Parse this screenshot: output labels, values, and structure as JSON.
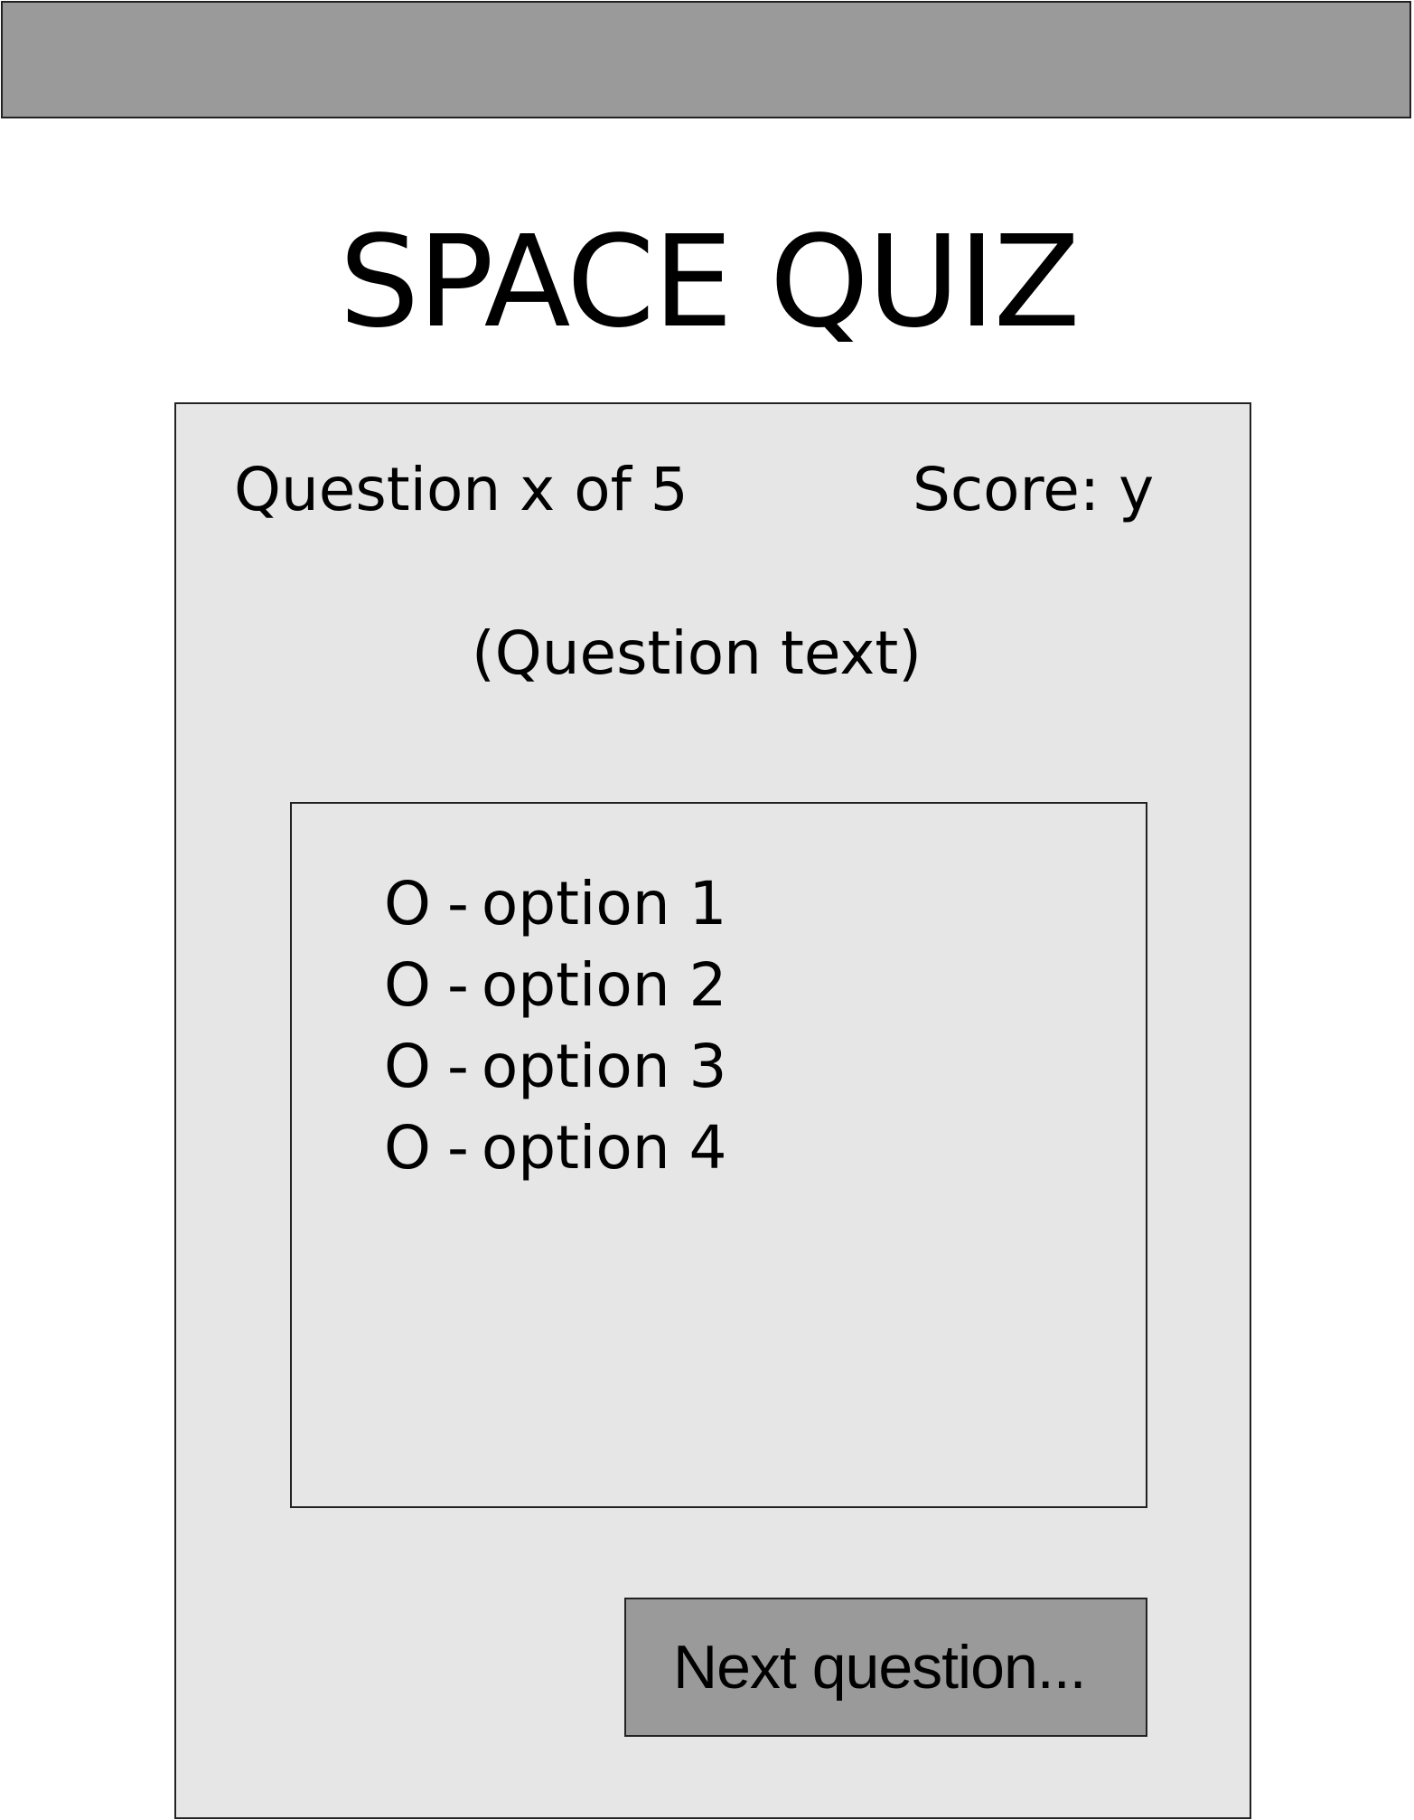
{
  "app": {
    "title": "SPACE QUIZ"
  },
  "quiz": {
    "question_counter": "Question x of 5",
    "score_label": "Score: y",
    "question_text": "(Question text)",
    "options": [
      {
        "marker": "O",
        "dash": "-",
        "label": "option 1"
      },
      {
        "marker": "O",
        "dash": "-",
        "label": "option 2"
      },
      {
        "marker": "O",
        "dash": "-",
        "label": "option 3"
      },
      {
        "marker": "O",
        "dash": "-",
        "label": "option 4"
      }
    ],
    "next_button_label": "Next question..."
  },
  "colors": {
    "bar": "#9a9a9a",
    "panel": "#e6e6e6",
    "border": "#222222"
  }
}
